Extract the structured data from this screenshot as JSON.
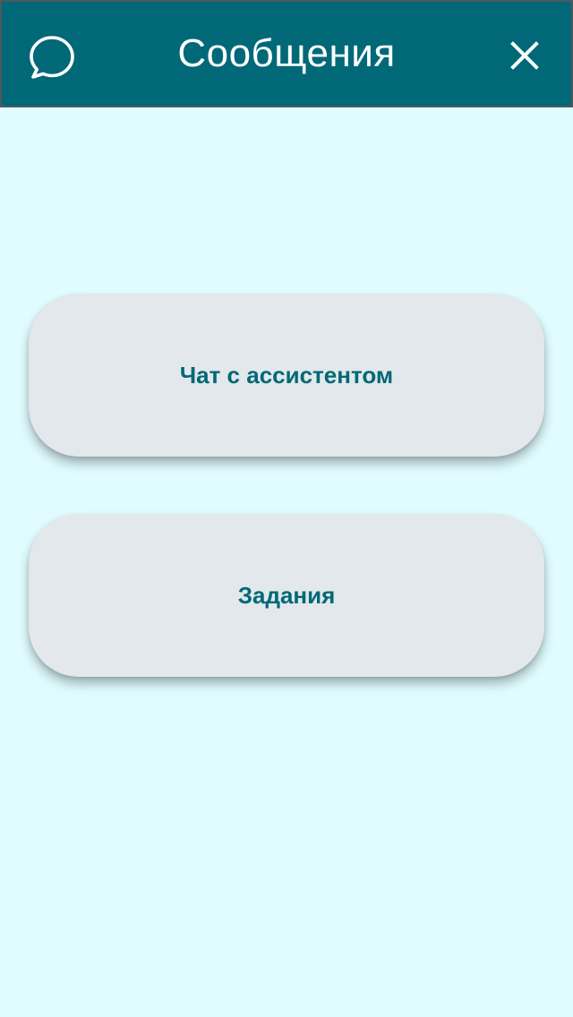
{
  "header": {
    "title": "Сообщения",
    "left_icon": "chat-bubble-icon",
    "right_icon": "close-icon"
  },
  "menu": {
    "items": [
      {
        "label": "Чат с ассистентом"
      },
      {
        "label": "Задания"
      }
    ]
  },
  "colors": {
    "header_bg": "#006877",
    "page_bg": "#e0fcff",
    "button_bg": "#e2e8eb",
    "button_text": "#006877"
  }
}
